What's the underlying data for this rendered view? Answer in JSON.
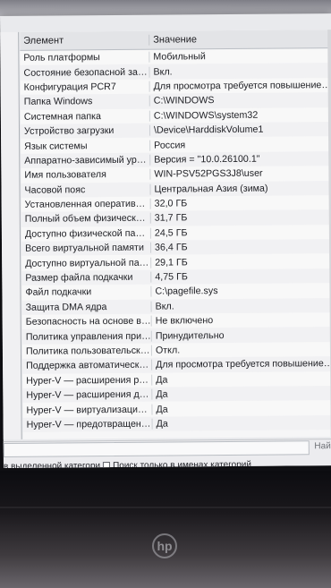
{
  "table": {
    "headers": {
      "name": "Элемент",
      "value": "Значение"
    },
    "rows": [
      {
        "name": "Роль платформы",
        "value": "Мобильный"
      },
      {
        "name": "Состояние безопасной загру...",
        "value": "Вкл."
      },
      {
        "name": "Конфигурация PCR7",
        "value": "Для просмотра требуется повышение пр"
      },
      {
        "name": "Папка Windows",
        "value": "C:\\WINDOWS"
      },
      {
        "name": "Системная папка",
        "value": "C:\\WINDOWS\\system32"
      },
      {
        "name": "Устройство загрузки",
        "value": "\\Device\\HarddiskVolume1"
      },
      {
        "name": "Язык системы",
        "value": "Россия"
      },
      {
        "name": "Аппаратно-зависимый уров...",
        "value": "Версия = \"10.0.26100.1\""
      },
      {
        "name": "Имя пользователя",
        "value": "WIN-PSV52PGS3J8\\user"
      },
      {
        "name": "Часовой пояс",
        "value": "Центральная Азия (зима)"
      },
      {
        "name": "Установленная оперативная...",
        "value": "32,0 ГБ"
      },
      {
        "name": "Полный объем физической ...",
        "value": "31,7 ГБ"
      },
      {
        "name": "Доступно физической памяти",
        "value": "24,5 ГБ"
      },
      {
        "name": "Всего виртуальной памяти",
        "value": "36,4 ГБ"
      },
      {
        "name": "Доступно виртуальной памя...",
        "value": "29,1 ГБ"
      },
      {
        "name": "Размер файла подкачки",
        "value": "4,75 ГБ"
      },
      {
        "name": "Файл подкачки",
        "value": "C:\\pagefile.sys"
      },
      {
        "name": "Защита DMA ядра",
        "value": "Вкл."
      },
      {
        "name": "Безопасность на основе вир...",
        "value": "Не включено"
      },
      {
        "name": "Политика управления прило...",
        "value": "Принудительно"
      },
      {
        "name": "Политика пользовательског...",
        "value": "Откл."
      },
      {
        "name": "Поддержка автоматического...",
        "value": "Для просмотра требуется повышение прав"
      },
      {
        "name": "Hyper-V — расширения реж...",
        "value": "Да"
      },
      {
        "name": "Hyper-V — расширения для ...",
        "value": "Да"
      },
      {
        "name": "Hyper-V — виртуализация вк...",
        "value": "Да"
      },
      {
        "name": "Hyper-V — предотвращение ...",
        "value": "Да"
      }
    ]
  },
  "search": {
    "find_label": "Най"
  },
  "options": {
    "selected_category_label": "в выделенной категори",
    "category_names_only_label": "Поиск только в именах категорий"
  },
  "laptop": {
    "logo_text": "hp"
  }
}
